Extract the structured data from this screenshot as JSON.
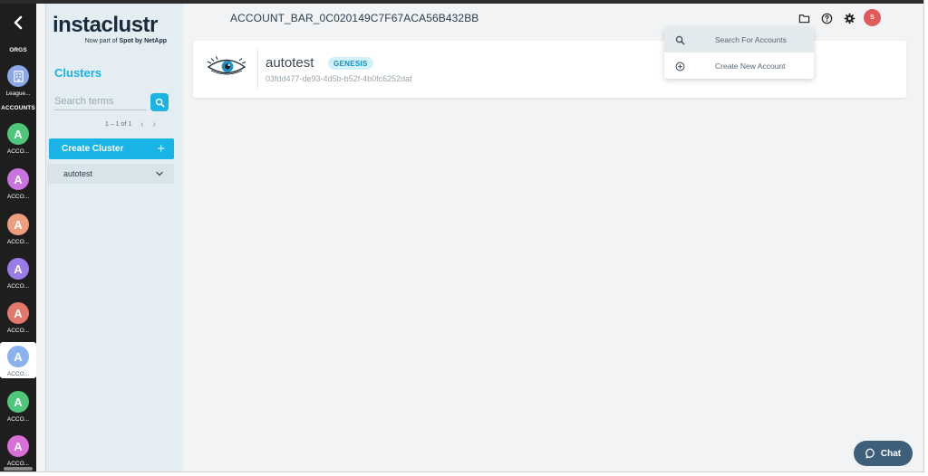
{
  "rail": {
    "orgs_heading": "ORGS",
    "org": {
      "label": "League...",
      "color": "#8aa7e8"
    },
    "accounts_heading": "ACCOUNTS",
    "accounts": [
      {
        "initial": "A",
        "label": "ACCO...",
        "color": "#4fc77a",
        "selected": false
      },
      {
        "initial": "A",
        "label": "ACCO...",
        "color": "#c873e0",
        "selected": false
      },
      {
        "initial": "A",
        "label": "ACCO...",
        "color": "#ee9d7f",
        "selected": false
      },
      {
        "initial": "A",
        "label": "ACCO...",
        "color": "#9b7be6",
        "selected": false
      },
      {
        "initial": "A",
        "label": "ACCO...",
        "color": "#e2786b",
        "selected": false
      },
      {
        "initial": "A",
        "label": "ACCO...",
        "color": "#8ab2ee",
        "selected": true
      },
      {
        "initial": "A",
        "label": "ACCO...",
        "color": "#4fc77a",
        "selected": false
      },
      {
        "initial": "A",
        "label": "ACCO...",
        "color": "#d86fd8",
        "selected": false
      }
    ]
  },
  "logo": {
    "wordmark": "instaclustr",
    "tagline_prefix": "Now part of ",
    "tagline_brand": "Spot by NetApp"
  },
  "panel": {
    "title": "Clusters",
    "search_placeholder": "Search terms",
    "pagination": "1 – 1 of 1",
    "create_label": "Create Cluster",
    "clusters": [
      {
        "name": "autotest"
      }
    ]
  },
  "header": {
    "account_title": "ACCOUNT_BAR_0C020149C7F67ACA56B432BB",
    "user_initial": "S"
  },
  "card": {
    "name": "autotest",
    "badge": "GENESIS",
    "cluster_id": "03fdd477-de93-4d5b-b52f-4b0fc6252daf"
  },
  "dropdown": {
    "items": [
      {
        "label": "Search For Accounts",
        "icon": "search-icon"
      },
      {
        "label": "Create New Account",
        "icon": "plus-circle-icon"
      }
    ]
  },
  "chat": {
    "label": "Chat"
  },
  "colors": {
    "accent": "#19b3e6",
    "rail": "#1e1e1e",
    "chat": "#3d5f7a"
  }
}
